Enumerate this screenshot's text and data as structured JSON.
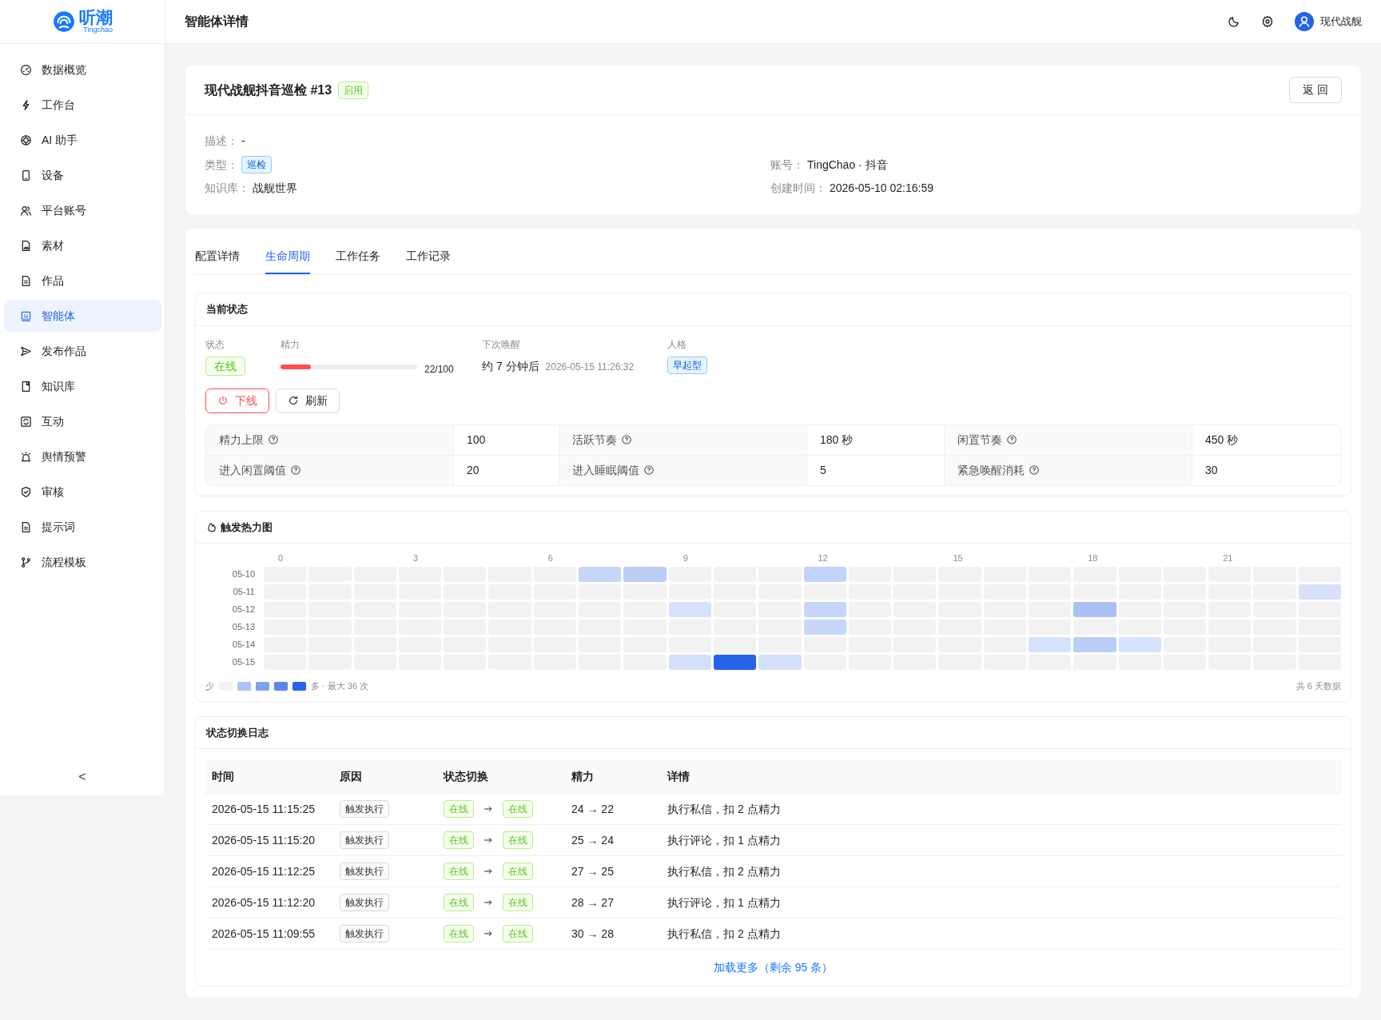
{
  "brand": {
    "name": "听潮",
    "sub": "Tingchao"
  },
  "sidebar": {
    "items": [
      {
        "label": "数据概览",
        "selected": false
      },
      {
        "label": "工作台",
        "selected": false
      },
      {
        "label": "AI 助手",
        "selected": false
      },
      {
        "label": "设备",
        "selected": false
      },
      {
        "label": "平台账号",
        "selected": false
      },
      {
        "label": "素材",
        "selected": false
      },
      {
        "label": "作品",
        "selected": false
      },
      {
        "label": "智能体",
        "selected": true
      },
      {
        "label": "发布作品",
        "selected": false
      },
      {
        "label": "知识库",
        "selected": false
      },
      {
        "label": "互动",
        "selected": false
      },
      {
        "label": "舆情预警",
        "selected": false
      },
      {
        "label": "审核",
        "selected": false
      },
      {
        "label": "提示词",
        "selected": false
      },
      {
        "label": "流程模板",
        "selected": false
      }
    ],
    "collapse": "<"
  },
  "header": {
    "title": "智能体详情",
    "user": "现代战舰"
  },
  "agent": {
    "title": "现代战舰抖音巡检 #13",
    "status": "启用",
    "back": "返 回",
    "description": {
      "label": "描述：",
      "value": "-"
    },
    "fields": [
      {
        "label": "类型：",
        "value": "巡检",
        "kind": "tag"
      },
      {
        "label": "账号：",
        "value": "TingChao · 抖音",
        "kind": "text"
      },
      {
        "label": "知识库：",
        "value": "战舰世界",
        "kind": "text"
      },
      {
        "label": "创建时间：",
        "value": "2026-05-10 02:16:59",
        "kind": "text"
      }
    ]
  },
  "tabs": [
    {
      "label": "配置详情",
      "selected": false
    },
    {
      "label": "生命周期",
      "selected": true
    },
    {
      "label": "工作任务",
      "selected": false
    },
    {
      "label": "工作记录",
      "selected": false
    }
  ],
  "current": {
    "title": "当前状态",
    "state_label": "状态",
    "state": "在线",
    "energy_label": "精力",
    "energy": {
      "level": 0.22,
      "reading": "22/100"
    },
    "wake_label": "下次唤醒",
    "wake": "约 7 分钟后",
    "wake_time": "2026-05-15 11:26:32",
    "persona_label": "人格",
    "persona": "早起型",
    "offline": "下线",
    "refresh": "刷新",
    "params": [
      {
        "label": "精力上限",
        "value": "100"
      },
      {
        "label": "活跃节奏",
        "value": "180 秒"
      },
      {
        "label": "闲置节奏",
        "value": "450 秒"
      },
      {
        "label": "进入闲置阈值",
        "value": "20"
      },
      {
        "label": "进入睡眠阈值",
        "value": "5"
      },
      {
        "label": "紧急唤醒消耗",
        "value": "30"
      }
    ]
  },
  "heatmap": {
    "title": "触发热力图",
    "hours": [
      "0",
      "3",
      "6",
      "9",
      "12",
      "15",
      "18",
      "21"
    ],
    "rows": [
      {
        "day": "05-10",
        "cells": [
          {
            "color": "#f2f2f2"
          },
          {
            "color": "#f2f2f2"
          },
          {
            "color": "#f2f2f2"
          },
          {
            "color": "#f2f2f2"
          },
          {
            "color": "#f2f2f2"
          },
          {
            "color": "#f2f2f2"
          },
          {
            "color": "#f2f2f2"
          },
          {
            "color": "#c6d6f8"
          },
          {
            "color": "#b9cdf7"
          },
          {
            "color": "#f2f2f2"
          },
          {
            "color": "#f2f2f2"
          },
          {
            "color": "#f2f2f2"
          },
          {
            "color": "#c1d3f8"
          },
          {
            "color": "#f2f2f2"
          },
          {
            "color": "#f2f2f2"
          },
          {
            "color": "#f2f2f2"
          },
          {
            "color": "#f2f2f2"
          },
          {
            "color": "#f2f2f2"
          },
          {
            "color": "#f2f2f2"
          },
          {
            "color": "#f2f2f2"
          },
          {
            "color": "#f2f2f2"
          },
          {
            "color": "#f2f2f2"
          },
          {
            "color": "#f2f2f2"
          },
          {
            "color": "#f2f2f2"
          }
        ]
      },
      {
        "day": "05-11",
        "cells": [
          {
            "color": "#f2f2f2"
          },
          {
            "color": "#f2f2f2"
          },
          {
            "color": "#f2f2f2"
          },
          {
            "color": "#f2f2f2"
          },
          {
            "color": "#f2f2f2"
          },
          {
            "color": "#f2f2f2"
          },
          {
            "color": "#f2f2f2"
          },
          {
            "color": "#f2f2f2"
          },
          {
            "color": "#f2f2f2"
          },
          {
            "color": "#f2f2f2"
          },
          {
            "color": "#f2f2f2"
          },
          {
            "color": "#f2f2f2"
          },
          {
            "color": "#f2f2f2"
          },
          {
            "color": "#f2f2f2"
          },
          {
            "color": "#f2f2f2"
          },
          {
            "color": "#f2f2f2"
          },
          {
            "color": "#f2f2f2"
          },
          {
            "color": "#f2f2f2"
          },
          {
            "color": "#f2f2f2"
          },
          {
            "color": "#f2f2f2"
          },
          {
            "color": "#f2f2f2"
          },
          {
            "color": "#f2f2f2"
          },
          {
            "color": "#f2f2f2"
          },
          {
            "color": "#d6e2fb"
          }
        ]
      },
      {
        "day": "05-12",
        "cells": [
          {
            "color": "#f2f2f2"
          },
          {
            "color": "#f2f2f2"
          },
          {
            "color": "#f2f2f2"
          },
          {
            "color": "#f2f2f2"
          },
          {
            "color": "#f2f2f2"
          },
          {
            "color": "#f2f2f2"
          },
          {
            "color": "#f2f2f2"
          },
          {
            "color": "#f2f2f2"
          },
          {
            "color": "#f2f2f2"
          },
          {
            "color": "#d6e2fb"
          },
          {
            "color": "#f2f2f2"
          },
          {
            "color": "#f2f2f2"
          },
          {
            "color": "#c6d6f8"
          },
          {
            "color": "#f2f2f2"
          },
          {
            "color": "#f2f2f2"
          },
          {
            "color": "#f2f2f2"
          },
          {
            "color": "#f2f2f2"
          },
          {
            "color": "#f2f2f2"
          },
          {
            "color": "#a9c1f5"
          },
          {
            "color": "#f2f2f2"
          },
          {
            "color": "#f2f2f2"
          },
          {
            "color": "#f2f2f2"
          },
          {
            "color": "#f2f2f2"
          },
          {
            "color": "#f2f2f2"
          }
        ]
      },
      {
        "day": "05-13",
        "cells": [
          {
            "color": "#f2f2f2"
          },
          {
            "color": "#f2f2f2"
          },
          {
            "color": "#f2f2f2"
          },
          {
            "color": "#f2f2f2"
          },
          {
            "color": "#f2f2f2"
          },
          {
            "color": "#f2f2f2"
          },
          {
            "color": "#f2f2f2"
          },
          {
            "color": "#f2f2f2"
          },
          {
            "color": "#f2f2f2"
          },
          {
            "color": "#f2f2f2"
          },
          {
            "color": "#f2f2f2"
          },
          {
            "color": "#f2f2f2"
          },
          {
            "color": "#c6d6f8"
          },
          {
            "color": "#f2f2f2"
          },
          {
            "color": "#f2f2f2"
          },
          {
            "color": "#f2f2f2"
          },
          {
            "color": "#f2f2f2"
          },
          {
            "color": "#f2f2f2"
          },
          {
            "color": "#f2f2f2"
          },
          {
            "color": "#f2f2f2"
          },
          {
            "color": "#f2f2f2"
          },
          {
            "color": "#f2f2f2"
          },
          {
            "color": "#f2f2f2"
          },
          {
            "color": "#f2f2f2"
          }
        ]
      },
      {
        "day": "05-14",
        "cells": [
          {
            "color": "#f2f2f2"
          },
          {
            "color": "#f2f2f2"
          },
          {
            "color": "#f2f2f2"
          },
          {
            "color": "#f2f2f2"
          },
          {
            "color": "#f2f2f2"
          },
          {
            "color": "#f2f2f2"
          },
          {
            "color": "#f2f2f2"
          },
          {
            "color": "#f2f2f2"
          },
          {
            "color": "#f2f2f2"
          },
          {
            "color": "#f2f2f2"
          },
          {
            "color": "#f2f2f2"
          },
          {
            "color": "#f2f2f2"
          },
          {
            "color": "#f2f2f2"
          },
          {
            "color": "#f2f2f2"
          },
          {
            "color": "#f2f2f2"
          },
          {
            "color": "#f2f2f2"
          },
          {
            "color": "#f2f2f2"
          },
          {
            "color": "#d6e2fb"
          },
          {
            "color": "#b9cdf7"
          },
          {
            "color": "#d6e2fb"
          },
          {
            "color": "#f2f2f2"
          },
          {
            "color": "#f2f2f2"
          },
          {
            "color": "#f2f2f2"
          },
          {
            "color": "#f2f2f2"
          }
        ]
      },
      {
        "day": "05-15",
        "cells": [
          {
            "color": "#f2f2f2"
          },
          {
            "color": "#f2f2f2"
          },
          {
            "color": "#f2f2f2"
          },
          {
            "color": "#f2f2f2"
          },
          {
            "color": "#f2f2f2"
          },
          {
            "color": "#f2f2f2"
          },
          {
            "color": "#f2f2f2"
          },
          {
            "color": "#f2f2f2"
          },
          {
            "color": "#f2f2f2"
          },
          {
            "color": "#d3e0fb"
          },
          {
            "color": "#2563eb"
          },
          {
            "color": "#d3e0fb"
          },
          {
            "color": "#f2f2f2"
          },
          {
            "color": "#f2f2f2"
          },
          {
            "color": "#f2f2f2"
          },
          {
            "color": "#f2f2f2"
          },
          {
            "color": "#f2f2f2"
          },
          {
            "color": "#f2f2f2"
          },
          {
            "color": "#f2f2f2"
          },
          {
            "color": "#f2f2f2"
          },
          {
            "color": "#f2f2f2"
          },
          {
            "color": "#f2f2f2"
          },
          {
            "color": "#f2f2f2"
          },
          {
            "color": "#f2f2f2"
          }
        ]
      }
    ],
    "legend": {
      "low": "少",
      "swatches": [
        {
          "color": "#f2f2f2"
        },
        {
          "color": "#aac4f7"
        },
        {
          "color": "#7fa2ef"
        },
        {
          "color": "#5a86ec"
        },
        {
          "color": "#2563eb"
        }
      ],
      "high": "多 · 最大 36 次"
    },
    "total": "共 6 天数据"
  },
  "log": {
    "title": "状态切换日志",
    "columns": [
      "时间",
      "原因",
      "状态切换",
      "精力",
      "详情"
    ],
    "rows": [
      {
        "time": "2026-05-15 11:15:25",
        "reason": "触发执行",
        "from": "在线",
        "to": "在线",
        "energy": "24 → 22",
        "detail": "执行私信，扣 2 点精力"
      },
      {
        "time": "2026-05-15 11:15:20",
        "reason": "触发执行",
        "from": "在线",
        "to": "在线",
        "energy": "25 → 24",
        "detail": "执行评论，扣 1 点精力"
      },
      {
        "time": "2026-05-15 11:12:25",
        "reason": "触发执行",
        "from": "在线",
        "to": "在线",
        "energy": "27 → 25",
        "detail": "执行私信，扣 2 点精力"
      },
      {
        "time": "2026-05-15 11:12:20",
        "reason": "触发执行",
        "from": "在线",
        "to": "在线",
        "energy": "28 → 27",
        "detail": "执行评论，扣 1 点精力"
      },
      {
        "time": "2026-05-15 11:09:55",
        "reason": "触发执行",
        "from": "在线",
        "to": "在线",
        "energy": "30 → 28",
        "detail": "执行私信，扣 2 点精力"
      }
    ],
    "more": "加载更多（剩余 95 条）"
  }
}
